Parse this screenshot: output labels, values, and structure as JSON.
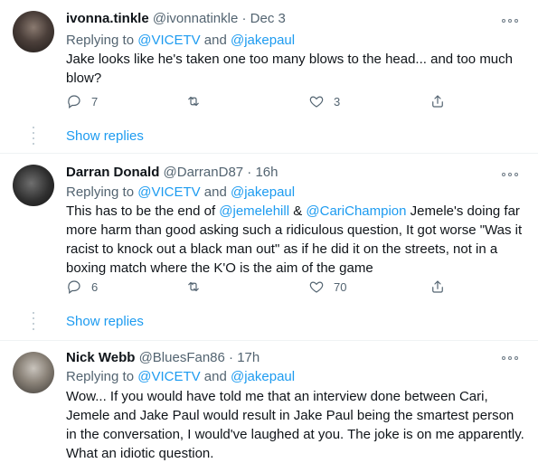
{
  "tweets": [
    {
      "display_name": "ivonna.tinkle",
      "handle": "@ivonnatinkle",
      "sep": "·",
      "time": "Dec 3",
      "replying_prefix": "Replying to",
      "replying_mention1": "@VICETV",
      "replying_and": "and",
      "replying_mention2": "@jakepaul",
      "text": "Jake looks like he's taken one too many blows to the head... and too much blow?",
      "replies": "7",
      "retweets": "",
      "likes": "3",
      "show_replies": "Show replies"
    },
    {
      "display_name": "Darran Donald",
      "handle": "@DarranD87",
      "sep": "·",
      "time": "16h",
      "replying_prefix": "Replying to",
      "replying_mention1": "@VICETV",
      "replying_and": "and",
      "replying_mention2": "@jakepaul",
      "text_part1": "This has to be the end of ",
      "text_mention1": "@jemelehill",
      "text_amp": " & ",
      "text_mention2": "@CariChampion",
      "text_part2": " Jemele's doing far more harm than good asking such a ridiculous question, It got worse \"Was it racist to knock out a black man out\" as if he did it on the streets, not in a boxing match where the K'O is the aim of the game",
      "replies": "6",
      "retweets": "",
      "likes": "70",
      "show_replies": "Show replies"
    },
    {
      "display_name": "Nick Webb",
      "handle": "@BluesFan86",
      "sep": "·",
      "time": "17h",
      "replying_prefix": "Replying to",
      "replying_mention1": "@VICETV",
      "replying_and": "and",
      "replying_mention2": "@jakepaul",
      "text": "Wow... If you would have told me that an interview done between Cari, Jemele and Jake Paul would result in Jake Paul being the smartest person in the conversation, I would've laughed at you. The joke is on me apparently. What an idiotic question."
    }
  ],
  "icons": {
    "reply": "reply-icon",
    "retweet": "retweet-icon",
    "like": "heart-icon",
    "share": "share-icon",
    "more": "more-options-icon"
  },
  "colors": {
    "accent": "#1d9bf0",
    "secondary_text": "#536471",
    "primary_text": "#0f1419",
    "divider": "#eff3f4"
  }
}
